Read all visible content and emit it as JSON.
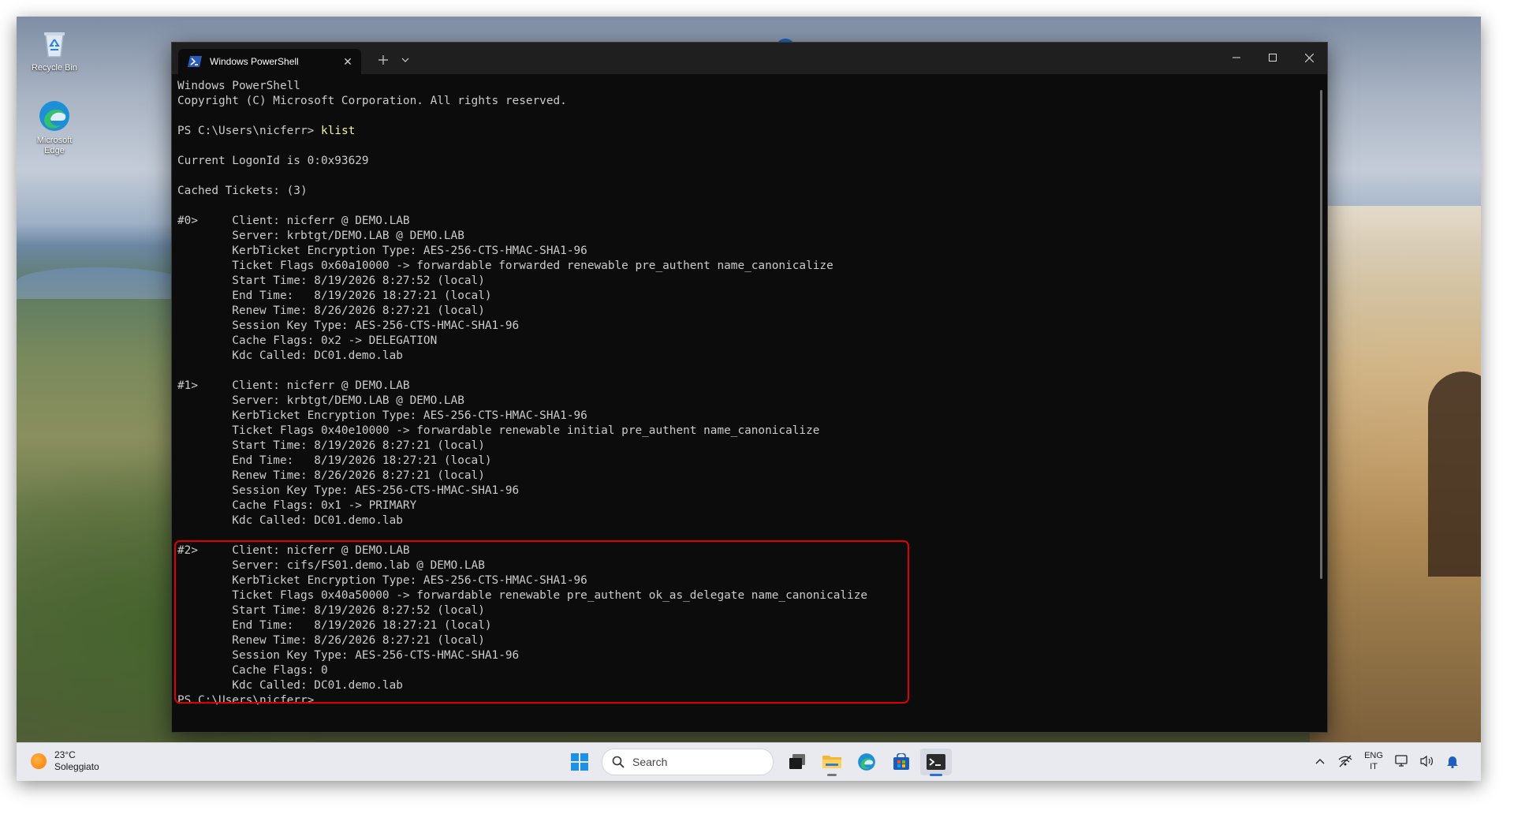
{
  "desktop": {
    "icons": [
      {
        "label": "Recycle Bin",
        "icon": "recycle-bin-icon"
      },
      {
        "label": "Microsoft Edge",
        "icon": "edge-icon"
      }
    ],
    "notification_icon": "info-icon"
  },
  "window": {
    "tab_title": "Windows PowerShell",
    "tab_icon": "powershell-icon",
    "controls": {
      "minimize": "minimize-icon",
      "maximize": "maximize-icon",
      "close": "close-icon"
    }
  },
  "console": {
    "lines": [
      "Windows PowerShell",
      "Copyright (C) Microsoft Corporation. All rights reserved.",
      "",
      "PS C:\\Users\\nicferr> ",
      "",
      "Current LogonId is 0:0x93629",
      "",
      "Cached Tickets: (3)",
      "",
      "#0>     Client: nicferr @ DEMO.LAB",
      "        Server: krbtgt/DEMO.LAB @ DEMO.LAB",
      "        KerbTicket Encryption Type: AES-256-CTS-HMAC-SHA1-96",
      "        Ticket Flags 0x60a10000 -> forwardable forwarded renewable pre_authent name_canonicalize",
      "        Start Time: 8/19/2026 8:27:52 (local)",
      "        End Time:   8/19/2026 18:27:21 (local)",
      "        Renew Time: 8/26/2026 8:27:21 (local)",
      "        Session Key Type: AES-256-CTS-HMAC-SHA1-96",
      "        Cache Flags: 0x2 -> DELEGATION",
      "        Kdc Called: DC01.demo.lab",
      "",
      "#1>     Client: nicferr @ DEMO.LAB",
      "        Server: krbtgt/DEMO.LAB @ DEMO.LAB",
      "        KerbTicket Encryption Type: AES-256-CTS-HMAC-SHA1-96",
      "        Ticket Flags 0x40e10000 -> forwardable renewable initial pre_authent name_canonicalize",
      "        Start Time: 8/19/2026 8:27:21 (local)",
      "        End Time:   8/19/2026 18:27:21 (local)",
      "        Renew Time: 8/26/2026 8:27:21 (local)",
      "        Session Key Type: AES-256-CTS-HMAC-SHA1-96",
      "        Cache Flags: 0x1 -> PRIMARY",
      "        Kdc Called: DC01.demo.lab",
      "",
      "#2>     Client: nicferr @ DEMO.LAB",
      "        Server: cifs/FS01.demo.lab @ DEMO.LAB",
      "        KerbTicket Encryption Type: AES-256-CTS-HMAC-SHA1-96",
      "        Ticket Flags 0x40a50000 -> forwardable renewable pre_authent ok_as_delegate name_canonicalize",
      "        Start Time: 8/19/2026 8:27:52 (local)",
      "        End Time:   8/19/2026 18:27:21 (local)",
      "        Renew Time: 8/26/2026 8:27:21 (local)",
      "        Session Key Type: AES-256-CTS-HMAC-SHA1-96",
      "        Cache Flags: 0",
      "        Kdc Called: DC01.demo.lab",
      "PS C:\\Users\\nicferr> "
    ],
    "command": "klist",
    "command_line_index": 3,
    "highlight_color": "#e10000"
  },
  "taskbar": {
    "weather": {
      "temperature": "23°C",
      "condition": "Soleggiato"
    },
    "search_placeholder": "Search",
    "apps": [
      "start-icon",
      "task-view-icon",
      "file-explorer-icon",
      "edge-icon",
      "store-icon",
      "terminal-icon"
    ],
    "language": {
      "code": "ENG",
      "region": "IT"
    }
  }
}
